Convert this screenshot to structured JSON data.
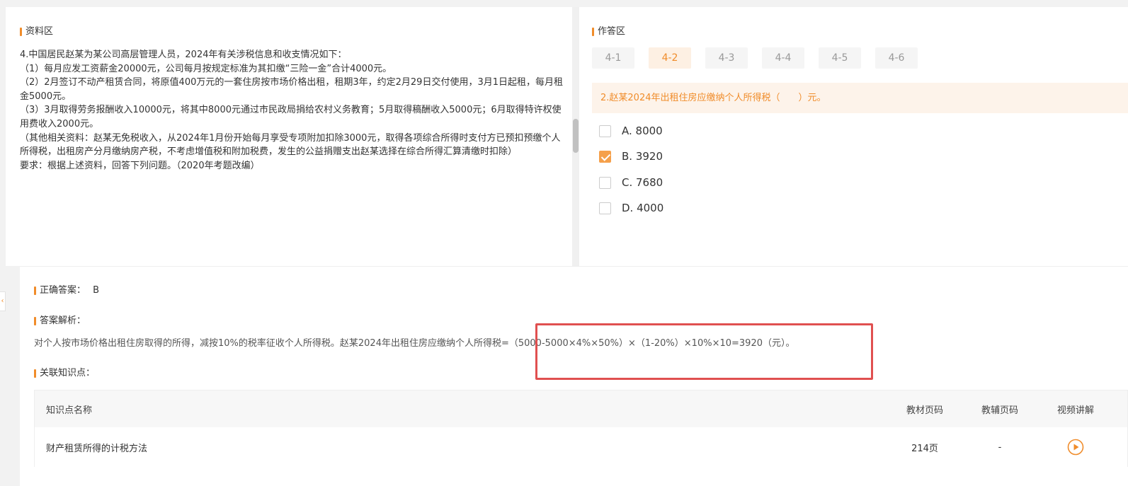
{
  "material": {
    "title": "资料区",
    "paragraphs": [
      "4.中国居民赵某为某公司高层管理人员，2024年有关涉税信息和收支情况如下：",
      "（1）每月应发工资薪金20000元，公司每月按规定标准为其扣缴“三险一金”合计4000元。",
      "（2）2月签订不动产租赁合同，将原值400万元的一套住房按市场价格出租，租期3年，约定2月29日交付使用，3月1日起租，每月租金5000元。",
      "（3）3月取得劳务报酬收入10000元，将其中8000元通过市民政局捐给农村义务教育；5月取得稿酬收入5000元；6月取得特许权使用费收入2000元。",
      "（其他相关资料：赵某无免税收入，从2024年1月份开始每月享受专项附加扣除3000元，取得各项综合所得时支付方已预扣预缴个人所得税，出租房产分月缴纳房产税，不考虑增值税和附加税费，发生的公益捐赠支出赵某选择在综合所得汇算清缴时扣除）",
      "要求：根据上述资料，回答下列问题。（2020年考题改编）"
    ]
  },
  "answer_area": {
    "title": "作答区",
    "tabs": [
      "4-1",
      "4-2",
      "4-3",
      "4-4",
      "4-5",
      "4-6"
    ],
    "active_tab": "4-2",
    "question": "2.赵某2024年出租住房应缴纳个人所得税（　　）元。",
    "options": [
      {
        "label": "A. 8000",
        "checked": false
      },
      {
        "label": "B. 3920",
        "checked": true
      },
      {
        "label": "C. 7680",
        "checked": false
      },
      {
        "label": "D. 4000",
        "checked": false
      }
    ]
  },
  "result": {
    "correct_label": "正确答案：",
    "correct_value": "B",
    "analysis_label": "答案解析：",
    "analysis_text": "对个人按市场价格出租住房取得的所得，减按10%的税率征收个人所得税。赵某2024年出租住房应缴纳个人所得税=（5000-5000×4%×50%）×（1-20%）×10%×10=3920（元）。",
    "knowledge_label": "关联知识点：",
    "table": {
      "headers": {
        "name": "知识点名称",
        "book_page": "教材页码",
        "aux_page": "教辅页码",
        "video": "视频讲解"
      },
      "rows": [
        {
          "name": "财产租赁所得的计税方法",
          "book_page": "214页",
          "aux_page": "-",
          "video_icon": "play-icon"
        }
      ]
    }
  },
  "colors": {
    "accent": "#f08c2a",
    "highlight": "#e05050",
    "checked": "#f5a04a"
  },
  "icons": {
    "collapse": "chevron-left-icon",
    "video": "play-circle-icon"
  }
}
